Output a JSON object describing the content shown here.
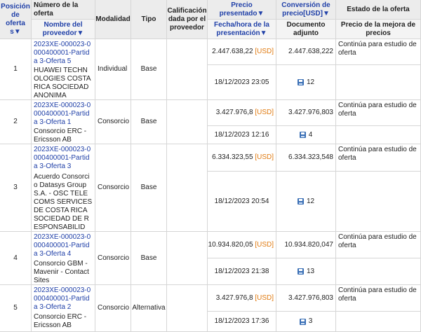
{
  "headers": {
    "position": "Posición de oferta s▼",
    "offer_number": "Número de la oferta",
    "supplier_name": "Nombre del proveedor▼",
    "modality": "Modalidad",
    "type": "Tipo",
    "rating": "Calificación dada por el proveedor",
    "price_presented": "Precio presentado▼",
    "datetime_presented": "Fecha/hora de la presentación▼",
    "price_conversion": "Conversión de precio[USD]▼",
    "attached_doc": "Documento adjunto",
    "offer_status": "Estado de la oferta",
    "best_price": "Precio de la mejora de precios"
  },
  "rows": [
    {
      "position": "1",
      "offer_number": "2023XE-000023-0000400001-Partida 3-Oferta 5",
      "supplier": "HUAWEI TECHNOLOGIES COSTA RICA SOCIEDAD ANONIMA",
      "modality": "Individual",
      "type": "Base",
      "price": "2.447.638,22",
      "currency": "[USD]",
      "conversion": "2.447.638,222",
      "status": "Continúa para estudio de oferta",
      "datetime": "18/12/2023 23:05",
      "docs": "12"
    },
    {
      "position": "2",
      "offer_number": "2023XE-000023-0000400001-Partida 3-Oferta 1",
      "supplier": "Consorcio ERC - Ericsson AB",
      "modality": "Consorcio",
      "type": "Base",
      "price": "3.427.976,8",
      "currency": "[USD]",
      "conversion": "3.427.976,803",
      "status": "Continúa para estudio de oferta",
      "datetime": "18/12/2023 12:16",
      "docs": "4"
    },
    {
      "position": "3",
      "offer_number": "2023XE-000023-0000400001-Partida 3-Oferta 3",
      "supplier": "Acuerdo Consorcio Datasys Group S.A. - OSC TELECOMS SERVICES DE COSTA RICA SOCIEDAD DE RESPONSABILID",
      "modality": "Consorcio",
      "type": "Base",
      "price": "6.334.323,55",
      "currency": "[USD]",
      "conversion": "6.334.323,548",
      "status": "Continúa para estudio de oferta",
      "datetime": "18/12/2023 20:54",
      "docs": "12"
    },
    {
      "position": "4",
      "offer_number": "2023XE-000023-0000400001-Partida 3-Oferta 4",
      "supplier": "Consorcio GBM - Mavenir - Contact Sites",
      "modality": "Consorcio",
      "type": "Base",
      "price": "10.934.820,05",
      "currency": "[USD]",
      "conversion": "10.934.820,047",
      "status": "Continúa para estudio de oferta",
      "datetime": "18/12/2023 21:38",
      "docs": "13"
    },
    {
      "position": "5",
      "offer_number": "2023XE-000023-0000400001-Partida 3-Oferta 2",
      "supplier": "Consorcio ERC - Ericsson AB",
      "modality": "Consorcio",
      "type": "Alternativa",
      "price": "3.427.976,8",
      "currency": "[USD]",
      "conversion": "3.427.976,803",
      "status": "Continúa para estudio de oferta",
      "datetime": "18/12/2023 17:36",
      "docs": "3"
    }
  ]
}
